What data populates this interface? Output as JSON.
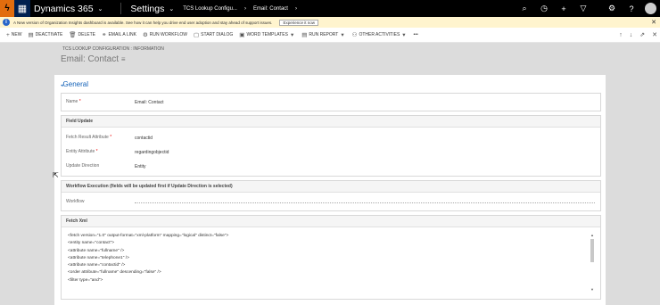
{
  "navbar": {
    "app_name": "Dynamics 365",
    "area": "Settings",
    "crumbs": [
      "TCS Lookup Configu...",
      "Email: Contact"
    ]
  },
  "notification": {
    "text": "A New version of Organization Insights dashboard is available. See how it can help you drive end user adoption and stay ahead of support issues.",
    "button": "Experience it now"
  },
  "commands": [
    "NEW",
    "DEACTIVATE",
    "DELETE",
    "EMAIL A LINK",
    "RUN WORKFLOW",
    "START DIALOG",
    "WORD TEMPLATES",
    "RUN REPORT",
    "OTHER ACTIVITIES"
  ],
  "header": {
    "breadcrumb": "TCS LOOKUP CONFIGURATION : INFORMATION",
    "title": "Email: Contact"
  },
  "general": {
    "heading": "General",
    "name_label": "Name",
    "name_value": "Email: Contact"
  },
  "field_update": {
    "heading": "Field Update",
    "fetch_result_label": "Fetch Result Attribute",
    "fetch_result_value": "contactid",
    "entity_attr_label": "Entity Attribute",
    "entity_attr_value": "regardingobjectid",
    "update_dir_label": "Update Direction",
    "update_dir_value": "Entity"
  },
  "workflow_section": {
    "heading": "Workflow Execution (fields will be updated first if Update Direction is selected)",
    "workflow_label": "Workflow"
  },
  "fetch_xml": {
    "heading": "Fetch Xml",
    "lines": [
      "<fetch version=\"1.0\" output-format=\"xml-platform\" mapping=\"logical\" distinct=\"false\">",
      "<entity name=\"contact\">",
      "<attribute name=\"fullname\" />",
      "<attribute name=\"telephone1\" />",
      "<attribute name=\"contactid\" />",
      "<order attribute=\"fullname\" descending=\"false\" />",
      "<filter type=\"and\">"
    ]
  }
}
